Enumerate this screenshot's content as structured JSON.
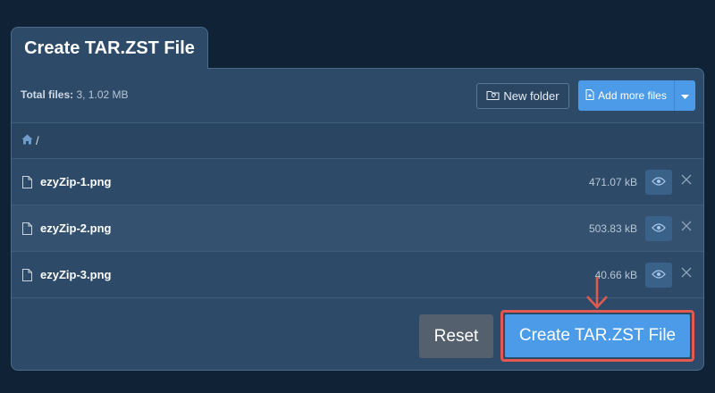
{
  "header": {
    "tab_title": "Create TAR.ZST File"
  },
  "toolbar": {
    "total_label": "Total files:",
    "total_value": "3, 1.02 MB",
    "new_folder_label": "New folder",
    "add_more_label": "Add more files"
  },
  "breadcrumb": {
    "path": "/"
  },
  "files": [
    {
      "name": "ezyZip-1.png",
      "size": "471.07 kB",
      "icon": "file-icon"
    },
    {
      "name": "ezyZip-2.png",
      "size": "503.83 kB",
      "icon": "file-icon"
    },
    {
      "name": "ezyZip-3.png",
      "size": "40.66 kB",
      "icon": "file-icon"
    }
  ],
  "actions": {
    "reset_label": "Reset",
    "create_label": "Create TAR.ZST File"
  },
  "colors": {
    "background": "#0f2236",
    "panel": "#2d4a69",
    "accent": "#4c9be8",
    "highlight": "#df5a50",
    "reset": "#54606d"
  }
}
